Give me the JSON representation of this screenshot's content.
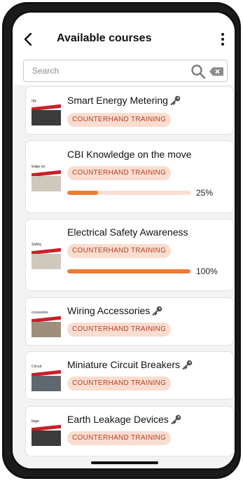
{
  "header": {
    "title": "Available courses"
  },
  "search": {
    "placeholder": "Search",
    "value": ""
  },
  "courses": [
    {
      "title": "Smart Energy Metering",
      "badge": "COUNTERHAND TRAINING",
      "locked": true,
      "thumb_caption": "rgy"
    },
    {
      "title": "CBI Knowledge on the move",
      "badge": "COUNTERHAND TRAINING",
      "locked": false,
      "progress": 25,
      "progress_label": "25%",
      "thumb_caption": "ledge on"
    },
    {
      "title": "Electrical Safety Awareness",
      "badge": "COUNTERHAND TRAINING",
      "locked": false,
      "progress": 100,
      "progress_label": "100%",
      "thumb_caption": "Safety"
    },
    {
      "title": "Wiring Accessories",
      "badge": "COUNTERHAND TRAINING",
      "locked": true,
      "thumb_caption": "ccessories"
    },
    {
      "title": "Miniature Circuit Breakers",
      "badge": "COUNTERHAND TRAINING",
      "locked": true,
      "thumb_caption": "Circuit"
    },
    {
      "title": "Earth Leakage Devices",
      "badge": "COUNTERHAND TRAINING",
      "locked": true,
      "thumb_caption": "kage"
    }
  ],
  "colors": {
    "accent": "#f07b33",
    "badge_bg": "#f9ddd0",
    "badge_text": "#b4422a",
    "progress_track": "#f8dfd2"
  },
  "icons": {
    "back": "back-arrow-icon",
    "menu": "kebab-menu-icon",
    "search": "search-icon",
    "clear": "clear-icon",
    "lock": "key-icon"
  }
}
